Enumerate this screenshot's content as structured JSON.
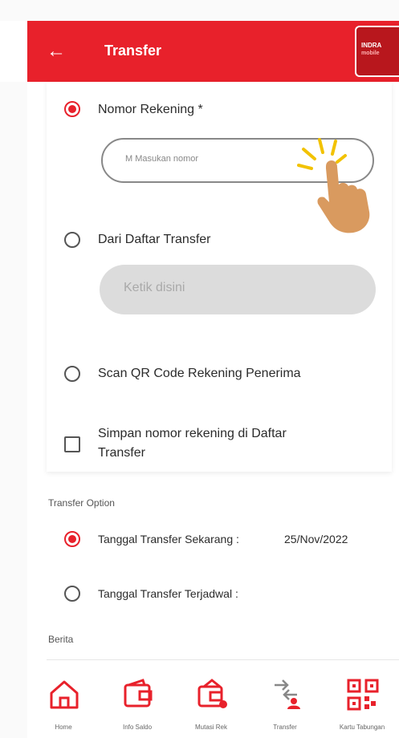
{
  "header": {
    "back_icon": "arrow-left-icon",
    "title": "Transfer",
    "brand_line1": "INDRA",
    "brand_line2": "mobile"
  },
  "form": {
    "account_number_label": "Nomor Rekening *",
    "account_number_placeholder": "M Masukan nomor",
    "from_list_label": "Dari Daftar Transfer",
    "from_list_dropdown": "Ketik disini",
    "scan_qr_label": "Scan QR Code Rekening Penerima",
    "save_line1": "Simpan nomor rekening di Daftar",
    "save_line2": "Transfer",
    "selected_source": "account_number"
  },
  "transfer_option": {
    "section_label": "Transfer Option",
    "now_label": "Tanggal Transfer Sekarang :",
    "now_date": "25/Nov/2022",
    "scheduled_label": "Tanggal Transfer Terjadwal :",
    "selected": "now"
  },
  "berita": {
    "section_label": "Berita"
  },
  "bottom_nav": {
    "items": [
      {
        "label": "Home",
        "icon": "home-icon"
      },
      {
        "label": "Info Saldo",
        "icon": "wallet-icon"
      },
      {
        "label": "Mutasi Rek",
        "icon": "wallet-mutation-icon"
      },
      {
        "label": "Transfer",
        "icon": "transfer-icon"
      },
      {
        "label": "Kartu Tabungan",
        "icon": "qr-code-icon"
      }
    ]
  },
  "colors": {
    "primary": "#e8212b",
    "brand_dark": "#b8171d",
    "hand": "#d99a5f"
  }
}
